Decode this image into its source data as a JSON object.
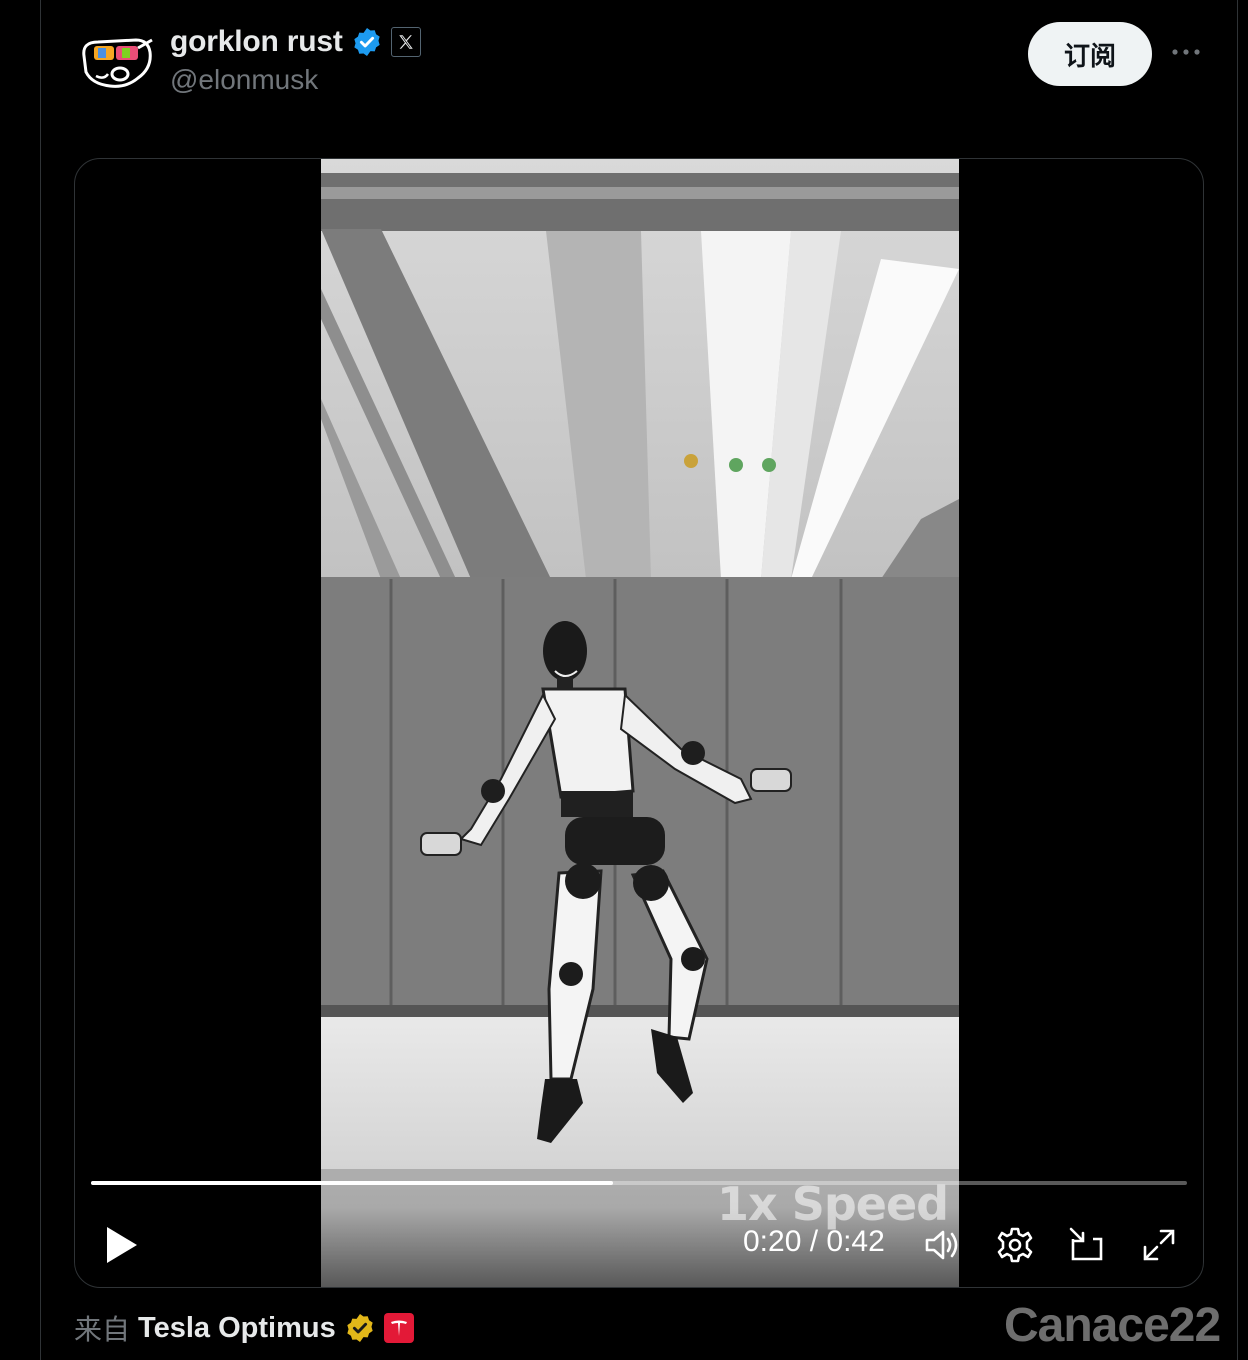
{
  "author": {
    "display_name": "gorklon rust",
    "handle": "@elonmusk",
    "verified_color": "#1d9bf0",
    "affiliation_icon": "x-logo-icon"
  },
  "actions": {
    "subscribe_label": "订阅",
    "more_label": "···"
  },
  "video": {
    "progress_fraction": 0.476,
    "current_time": "0:20",
    "duration": "0:42",
    "time_separator": " / ",
    "speed_overlay": "1x Speed",
    "state": "paused",
    "controls": [
      "play-icon",
      "volume-icon",
      "settings-gear-icon",
      "picture-in-picture-icon",
      "fullscreen-icon"
    ]
  },
  "source": {
    "prefix": "来自",
    "name": "Tesla Optimus",
    "badge_color": "#e2b719",
    "logo_color": "#e31937"
  },
  "watermark": "Canace22"
}
